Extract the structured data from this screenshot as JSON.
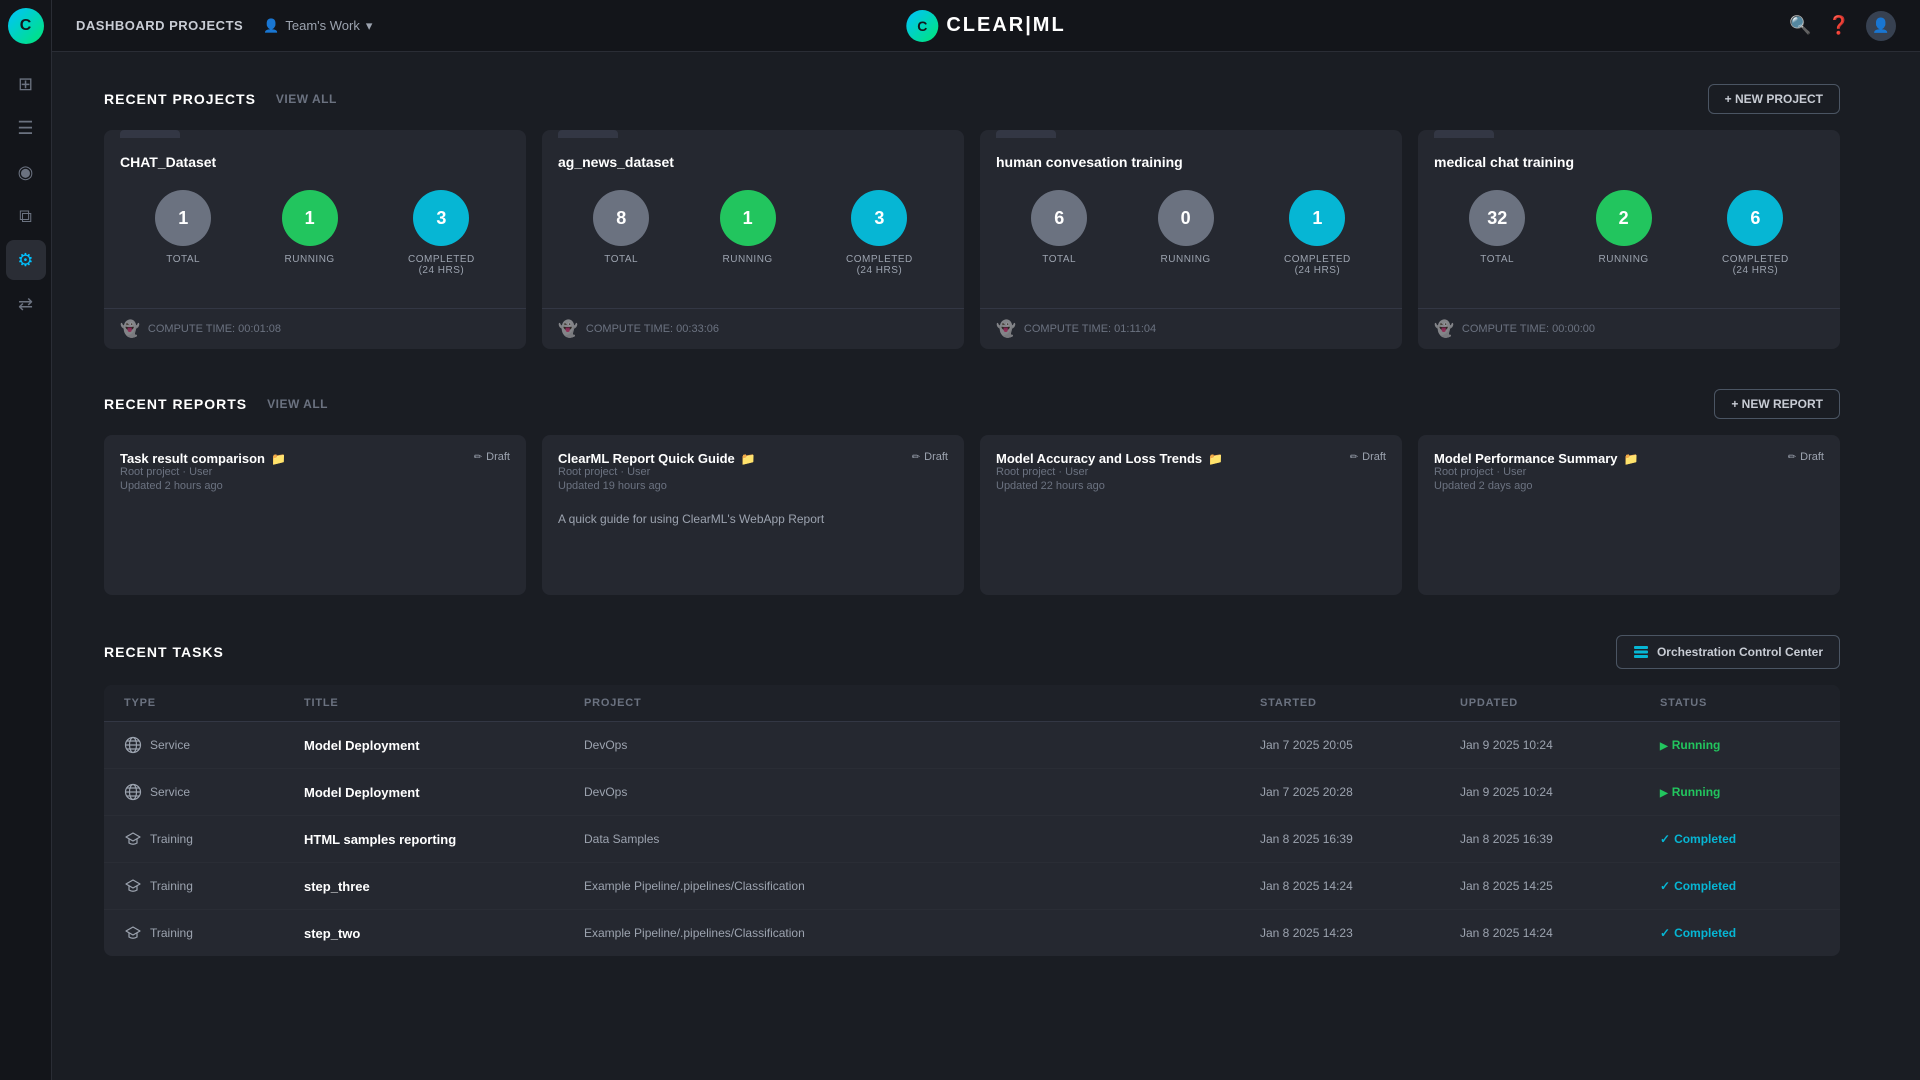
{
  "sidebar": {
    "logo_letter": "C",
    "icons": [
      {
        "name": "dashboard-icon",
        "symbol": "⊞",
        "active": false
      },
      {
        "name": "tasks-icon",
        "symbol": "≡",
        "active": false
      },
      {
        "name": "experiments-icon",
        "symbol": "◎",
        "active": false
      },
      {
        "name": "models-icon",
        "symbol": "⧉",
        "active": false
      },
      {
        "name": "settings-icon",
        "symbol": "⚙",
        "active": true
      },
      {
        "name": "pipelines-icon",
        "symbol": "⇄",
        "active": false
      }
    ]
  },
  "topnav": {
    "title": "DASHBOARD PROJECTS",
    "team_label": "Team's Work",
    "logo_letter": "C",
    "logo_text": "CLEAR|ML"
  },
  "recent_projects": {
    "section_title": "RECENT PROJECTS",
    "view_all": "VIEW ALL",
    "new_button": "+ NEW PROJECT",
    "projects": [
      {
        "name": "CHAT_Dataset",
        "total": 1,
        "running": 1,
        "completed": 3,
        "compute_time": "00:01:08"
      },
      {
        "name": "ag_news_dataset",
        "total": 8,
        "running": 1,
        "completed": 3,
        "compute_time": "00:33:06"
      },
      {
        "name": "human convesation training",
        "total": 6,
        "running": 0,
        "completed": 1,
        "compute_time": "01:11:04"
      },
      {
        "name": "medical chat training",
        "total": 32,
        "running": 2,
        "completed": 6,
        "compute_time": "00:00:00"
      }
    ],
    "labels": {
      "total": "TOTAL",
      "running": "RUNNING",
      "completed": "COMPLETED",
      "completed_sub": "(24 hrs)",
      "compute_prefix": "COMPUTE TIME: "
    }
  },
  "recent_reports": {
    "section_title": "RECENT REPORTS",
    "view_all": "VIEW ALL",
    "new_button": "+ NEW REPORT",
    "reports": [
      {
        "title": "Task result comparison",
        "project": "Root project",
        "user": "User",
        "updated": "Updated 2 hours ago",
        "status": "Draft",
        "description": ""
      },
      {
        "title": "ClearML Report Quick Guide",
        "project": "Root project",
        "user": "User",
        "updated": "Updated 19 hours ago",
        "status": "Draft",
        "description": "A quick guide for using ClearML's WebApp Report"
      },
      {
        "title": "Model Accuracy and Loss Trends",
        "project": "Root project",
        "user": "User",
        "updated": "Updated 22 hours ago",
        "status": "Draft",
        "description": ""
      },
      {
        "title": "Model Performance Summary",
        "project": "Root project",
        "user": "User",
        "updated": "Updated 2 days ago",
        "status": "Draft",
        "description": ""
      }
    ]
  },
  "recent_tasks": {
    "section_title": "RECENT TASKS",
    "orchestration_button": "Orchestration Control Center",
    "columns": [
      "TYPE",
      "TITLE",
      "PROJECT",
      "STARTED",
      "UPDATED",
      "STATUS"
    ],
    "tasks": [
      {
        "type": "Service",
        "type_icon": "globe",
        "title": "Model Deployment",
        "project": "DevOps",
        "started": "Jan 7 2025 20:05",
        "updated": "Jan 9 2025 10:24",
        "status": "Running",
        "status_type": "running"
      },
      {
        "type": "Service",
        "type_icon": "globe",
        "title": "Model Deployment",
        "project": "DevOps",
        "started": "Jan 7 2025 20:28",
        "updated": "Jan 9 2025 10:24",
        "status": "Running",
        "status_type": "running"
      },
      {
        "type": "Training",
        "type_icon": "grad",
        "title": "HTML samples reporting",
        "project": "Data Samples",
        "started": "Jan 8 2025 16:39",
        "updated": "Jan 8 2025 16:39",
        "status": "Completed",
        "status_type": "completed"
      },
      {
        "type": "Training",
        "type_icon": "grad",
        "title": "step_three",
        "project": "Example Pipeline/.pipelines/Classification",
        "started": "Jan 8 2025 14:24",
        "updated": "Jan 8 2025 14:25",
        "status": "Completed",
        "status_type": "completed"
      },
      {
        "type": "Training",
        "type_icon": "grad",
        "title": "step_two",
        "project": "Example Pipeline/.pipelines/Classification",
        "started": "Jan 8 2025 14:23",
        "updated": "Jan 8 2025 14:24",
        "status": "Completed",
        "status_type": "completed"
      }
    ]
  }
}
